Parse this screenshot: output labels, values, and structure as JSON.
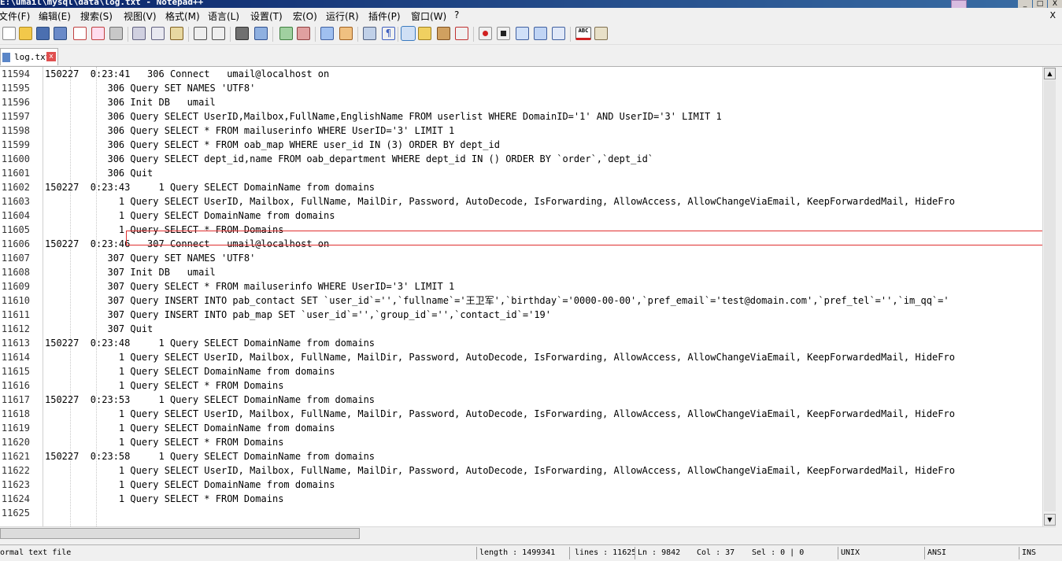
{
  "window": {
    "title": "E:\\umail\\mysql\\data\\log.txt - Notepad++",
    "controls": [
      "_",
      "□",
      "X"
    ]
  },
  "menu": {
    "items": [
      "文件(F)",
      "编辑(E)",
      "搜索(S)",
      "视图(V)",
      "格式(M)",
      "语言(L)",
      "设置(T)",
      "宏(O)",
      "运行(R)",
      "插件(P)",
      "窗口(W)",
      "?"
    ],
    "close": "X"
  },
  "toolbar": {
    "icons": [
      "new-file-icon",
      "open-file-icon",
      "save-icon",
      "save-all-icon",
      "close-icon",
      "close-all-icon",
      "print-icon",
      "cut-icon",
      "copy-icon",
      "paste-icon",
      "undo-icon",
      "redo-icon",
      "find-icon",
      "replace-icon",
      "zoom-in-icon",
      "zoom-out-icon",
      "sync-vertical-icon",
      "sync-horizontal-icon",
      "word-wrap-icon",
      "show-all-chars-icon",
      "indent-guide-icon",
      "folder-as-workspace-icon",
      "doc-map-icon",
      "function-list-icon",
      "record-macro-icon",
      "stop-record-icon",
      "play-macro-icon",
      "run-macro-multiple-icon",
      "save-macro-icon",
      "spell-check-icon",
      "html-tag-icon"
    ],
    "spellcheck_label": "ABC"
  },
  "tabs": [
    {
      "label": "log.txt",
      "close": "x"
    }
  ],
  "editor": {
    "lines": [
      {
        "num": "11594",
        "text": "150227  0:23:41   306 Connect   umail@localhost on"
      },
      {
        "num": "11595",
        "text": "           306 Query SET NAMES 'UTF8'"
      },
      {
        "num": "11596",
        "text": "           306 Init DB   umail"
      },
      {
        "num": "11597",
        "text": "           306 Query SELECT UserID,Mailbox,FullName,EnglishName FROM userlist WHERE DomainID='1' AND UserID='3' LIMIT 1"
      },
      {
        "num": "11598",
        "text": "           306 Query SELECT * FROM mailuserinfo WHERE UserID='3' LIMIT 1"
      },
      {
        "num": "11599",
        "text": "           306 Query SELECT * FROM oab_map WHERE user_id IN (3) ORDER BY dept_id"
      },
      {
        "num": "11600",
        "text": "           306 Query SELECT dept_id,name FROM oab_department WHERE dept_id IN () ORDER BY `order`,`dept_id`"
      },
      {
        "num": "11601",
        "text": "           306 Quit"
      },
      {
        "num": "11602",
        "text": "150227  0:23:43     1 Query SELECT DomainName from domains"
      },
      {
        "num": "11603",
        "text": "             1 Query SELECT UserID, Mailbox, FullName, MailDir, Password, AutoDecode, IsForwarding, AllowAccess, AllowChangeViaEmail, KeepForwardedMail, HideFro"
      },
      {
        "num": "11604",
        "text": "             1 Query SELECT DomainName from domains"
      },
      {
        "num": "11605",
        "text": "             1 Query SELECT * FROM Domains"
      },
      {
        "num": "11606",
        "text": "150227  0:23:46   307 Connect   umail@localhost on"
      },
      {
        "num": "11607",
        "text": "           307 Query SET NAMES 'UTF8'"
      },
      {
        "num": "11608",
        "text": "           307 Init DB   umail"
      },
      {
        "num": "11609",
        "text": "           307 Query SELECT * FROM mailuserinfo WHERE UserID='3' LIMIT 1"
      },
      {
        "num": "11610",
        "text": "           307 Query INSERT INTO pab_contact SET `user_id`='',`fullname`='王卫军',`birthday`='0000-00-00',`pref_email`='test@domain.com',`pref_tel`='',`im_qq`='"
      },
      {
        "num": "11611",
        "text": "           307 Query INSERT INTO pab_map SET `user_id`='',`group_id`='',`contact_id`='19'"
      },
      {
        "num": "11612",
        "text": "           307 Quit"
      },
      {
        "num": "11613",
        "text": "150227  0:23:48     1 Query SELECT DomainName from domains"
      },
      {
        "num": "11614",
        "text": "             1 Query SELECT UserID, Mailbox, FullName, MailDir, Password, AutoDecode, IsForwarding, AllowAccess, AllowChangeViaEmail, KeepForwardedMail, HideFro"
      },
      {
        "num": "11615",
        "text": "             1 Query SELECT DomainName from domains"
      },
      {
        "num": "11616",
        "text": "             1 Query SELECT * FROM Domains"
      },
      {
        "num": "11617",
        "text": "150227  0:23:53     1 Query SELECT DomainName from domains"
      },
      {
        "num": "11618",
        "text": "             1 Query SELECT UserID, Mailbox, FullName, MailDir, Password, AutoDecode, IsForwarding, AllowAccess, AllowChangeViaEmail, KeepForwardedMail, HideFro"
      },
      {
        "num": "11619",
        "text": "             1 Query SELECT DomainName from domains"
      },
      {
        "num": "11620",
        "text": "             1 Query SELECT * FROM Domains"
      },
      {
        "num": "11621",
        "text": "150227  0:23:58     1 Query SELECT DomainName from domains"
      },
      {
        "num": "11622",
        "text": "             1 Query SELECT UserID, Mailbox, FullName, MailDir, Password, AutoDecode, IsForwarding, AllowAccess, AllowChangeViaEmail, KeepForwardedMail, HideFro"
      },
      {
        "num": "11623",
        "text": "             1 Query SELECT DomainName from domains"
      },
      {
        "num": "11624",
        "text": "             1 Query SELECT * FROM Domains"
      },
      {
        "num": "11625",
        "text": ""
      }
    ]
  },
  "status": {
    "filetype": "ormal text file",
    "length": "length : 1499341",
    "lines": "lines : 11625",
    "ln": "Ln : 9842",
    "col": "Col : 37",
    "sel": "Sel : 0 | 0",
    "eol": "UNIX",
    "encoding": "ANSI",
    "mode": "INS"
  },
  "colors": {
    "highlight_box": "#e03030",
    "title_bar": "#0a246a"
  }
}
